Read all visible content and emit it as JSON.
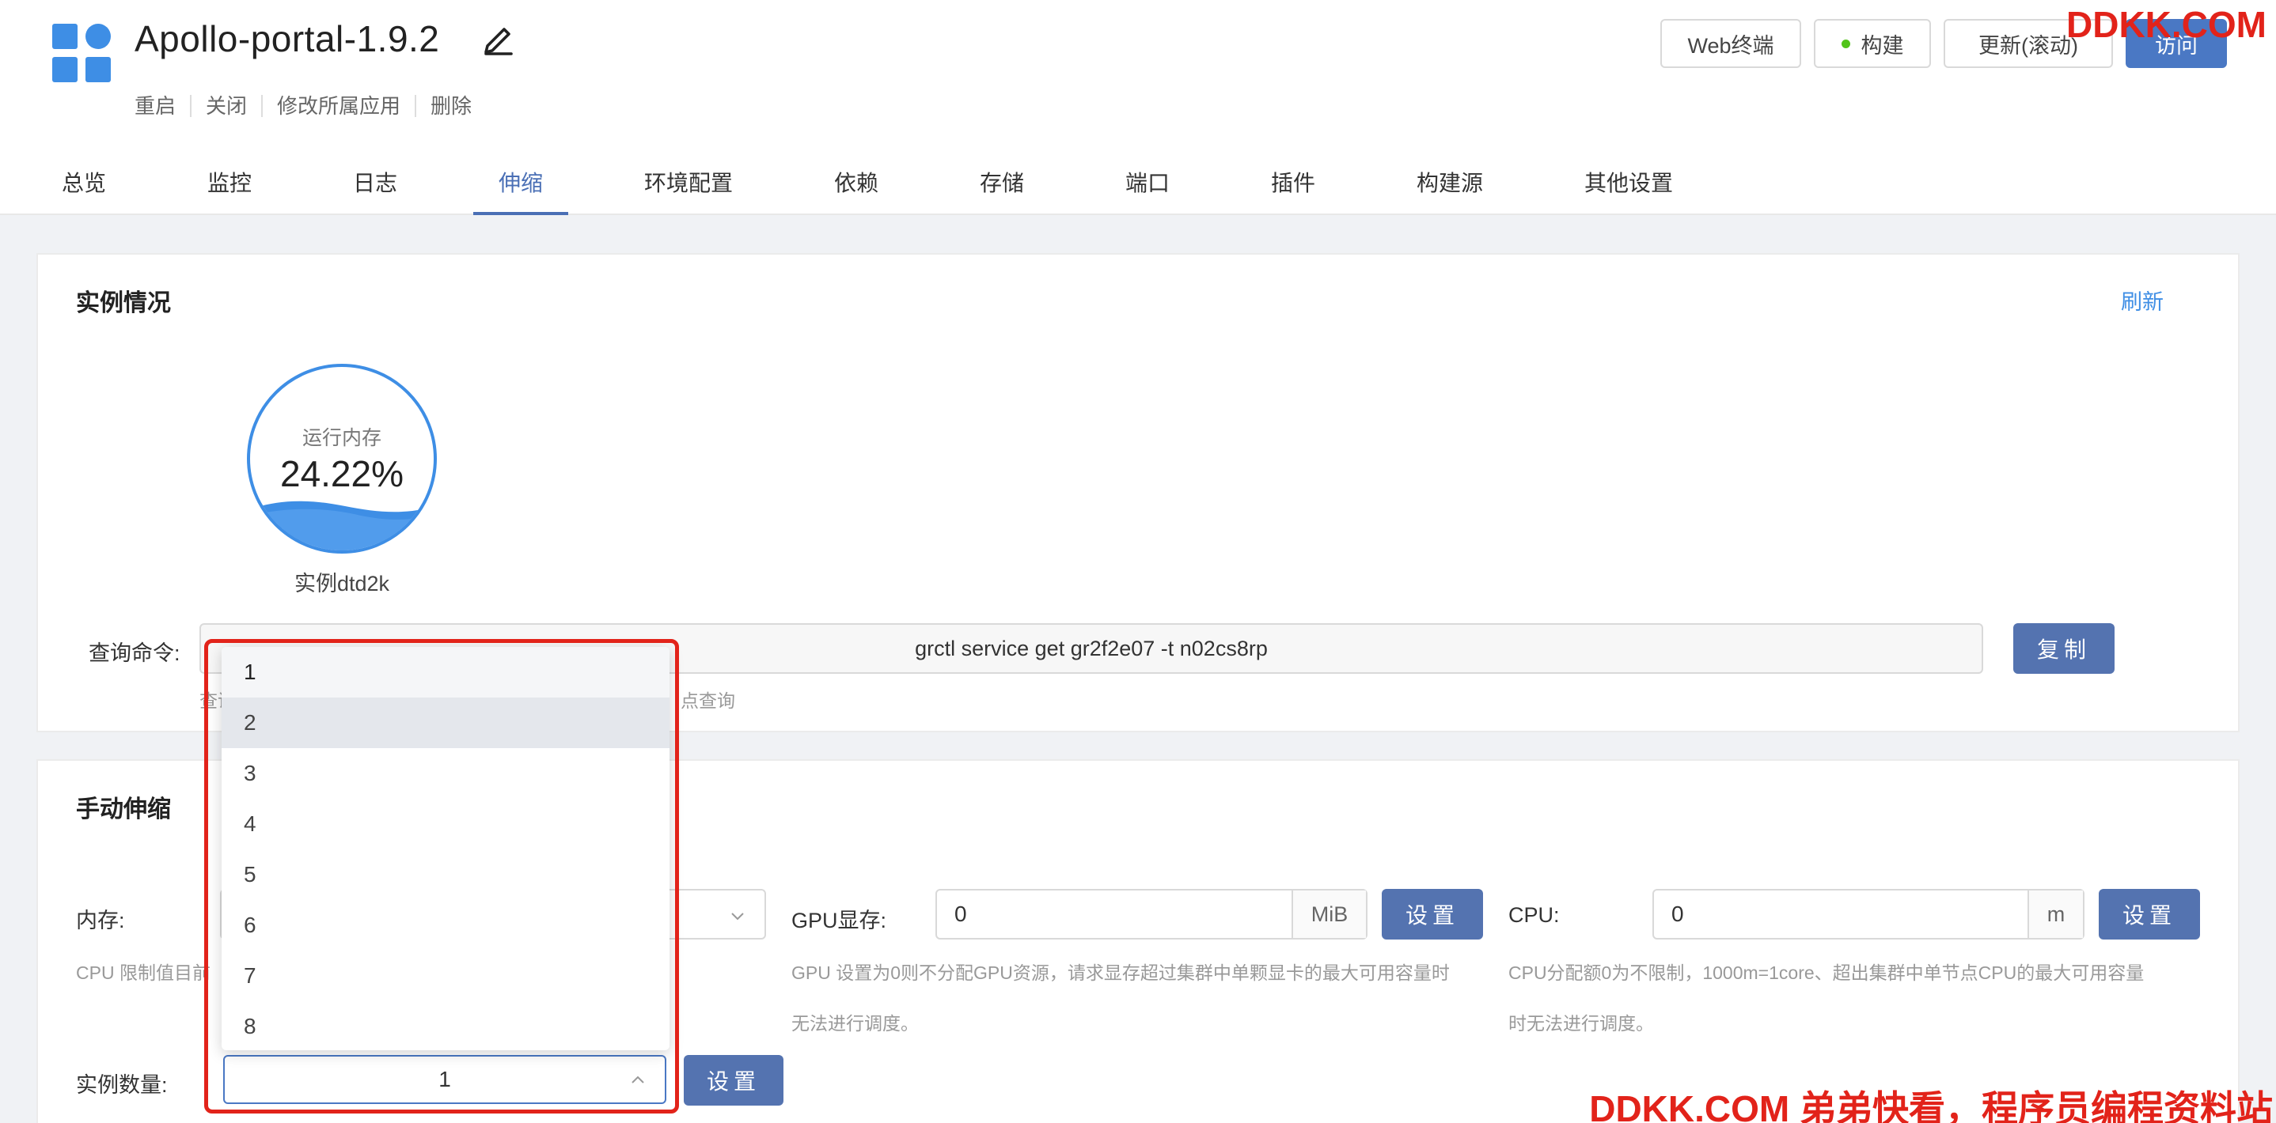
{
  "app": {
    "title": "Apollo-portal-1.9.2",
    "sub_actions": [
      "重启",
      "关闭",
      "修改所属应用",
      "删除"
    ]
  },
  "top_buttons": {
    "web_terminal": "Web终端",
    "build": "构建",
    "update": "更新(滚动)",
    "visit": "访问"
  },
  "tabs": [
    "总览",
    "监控",
    "日志",
    "伸缩",
    "环境配置",
    "依赖",
    "存储",
    "端口",
    "插件",
    "构建源",
    "其他设置"
  ],
  "active_tab": "伸缩",
  "instance_card": {
    "title": "实例情况",
    "refresh": "刷新",
    "gauge_label": "运行内存",
    "gauge_value": "24.22%",
    "gauge_fraction": 0.2422,
    "instance_name": "实例dtd2k",
    "query_label": "查询命令:",
    "query_command": "grctl service get gr2f2e07 -t n02cs8rp",
    "copy_button": "复制",
    "hint_left": "查询",
    "hint_right": "点查询"
  },
  "manual_scale": {
    "title": "手动伸缩",
    "memory_label": "内存:",
    "memory_hint": "CPU 限制值目前",
    "gpu_label": "GPU显存:",
    "gpu_value": "0",
    "gpu_unit": "MiB",
    "gpu_set": "设置",
    "gpu_hint_1": "GPU 设置为0则不分配GPU资源，请求显存超过集群中单颗显卡的最大可用容量时",
    "gpu_hint_2": "无法进行调度。",
    "cpu_label": "CPU:",
    "cpu_value": "0",
    "cpu_unit": "m",
    "cpu_set": "设置",
    "cpu_hint_1": "CPU分配额0为不限制，1000m=1core、超出集群中单节点CPU的最大可用容量",
    "cpu_hint_2": "时无法进行调度。",
    "instances_label": "实例数量:",
    "instances_value": "1",
    "instances_set": "设置",
    "instance_options": [
      "1",
      "2",
      "3",
      "4",
      "5",
      "6",
      "7",
      "8"
    ]
  },
  "watermark": {
    "top": "DDKK.COM",
    "bottom": "DDKK.COM 弟弟快看，程序员编程资料站"
  },
  "colors": {
    "accent": "#4a6fb5",
    "primary_button": "#5473b0",
    "gauge_blue": "#3e8ee5",
    "watermark_red": "#e2231a"
  }
}
